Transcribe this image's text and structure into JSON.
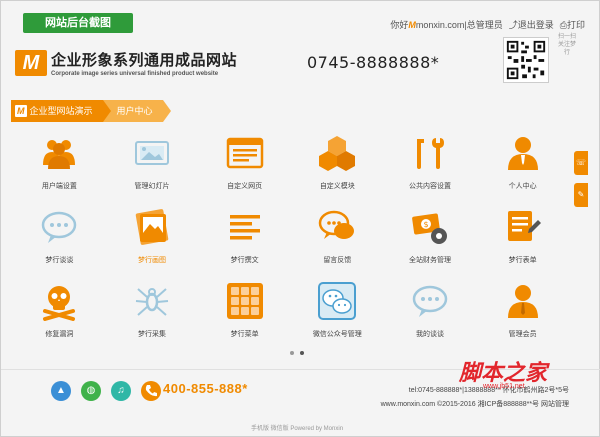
{
  "tag": "网站后台截图",
  "topbar": {
    "greeting": "你好",
    "brand_m": "M",
    "site": "monxin.com",
    "sep": "|",
    "role": "总管理员",
    "logout": "退出登录",
    "print": "打印"
  },
  "logo": {
    "mark": "M",
    "title": "企业形象系列通用成品网站",
    "subtitle": "Corporate image series universal finished product website"
  },
  "phone_top": "0745-8888888*",
  "qr_side_text": "扫一扫关注梦行",
  "breadcrumb": {
    "mini": "M",
    "item1": "企业型网站演示",
    "item2": "用户中心"
  },
  "tiles": [
    {
      "label": "用户端设置",
      "icon": "users-icon"
    },
    {
      "label": "管理幻灯片",
      "icon": "slides-icon"
    },
    {
      "label": "自定义网页",
      "icon": "webpage-icon"
    },
    {
      "label": "自定义模块",
      "icon": "cubes-icon"
    },
    {
      "label": "公共内容设置",
      "icon": "tools-icon"
    },
    {
      "label": "个人中心",
      "icon": "personal-icon"
    },
    {
      "label": "梦行谈谈",
      "icon": "chat-bubble-icon"
    },
    {
      "label": "梦行画图",
      "icon": "picture-icon",
      "highlight": true
    },
    {
      "label": "梦行撰文",
      "icon": "article-icon"
    },
    {
      "label": "留言反馈",
      "icon": "messages-icon"
    },
    {
      "label": "全站财务管理",
      "icon": "finance-icon"
    },
    {
      "label": "梦行表单",
      "icon": "form-icon"
    },
    {
      "label": "修复漏洞",
      "icon": "skull-icon"
    },
    {
      "label": "梦行采集",
      "icon": "spider-icon"
    },
    {
      "label": "梦行菜单",
      "icon": "menu-grid-icon"
    },
    {
      "label": "微信公众号管理",
      "icon": "wechat-icon"
    },
    {
      "label": "我的谈谈",
      "icon": "my-chat-icon"
    },
    {
      "label": "管理会员",
      "icon": "member-icon"
    }
  ],
  "footer": {
    "phone": "400-855-888*",
    "line1": "tel:0745-888888*|13888888** 怀化市鹤州路2号*5号",
    "line2": "www.monxin.com ©2015-2016 湘ICP备888888**号 网站管理",
    "bottom": "手机版  微信版  Powered by Monxin"
  },
  "watermark": {
    "text": "脚本之家",
    "url": "www.jb51.net"
  },
  "colors": {
    "accent": "#f08a00",
    "tag_green": "#2f9b3a"
  }
}
